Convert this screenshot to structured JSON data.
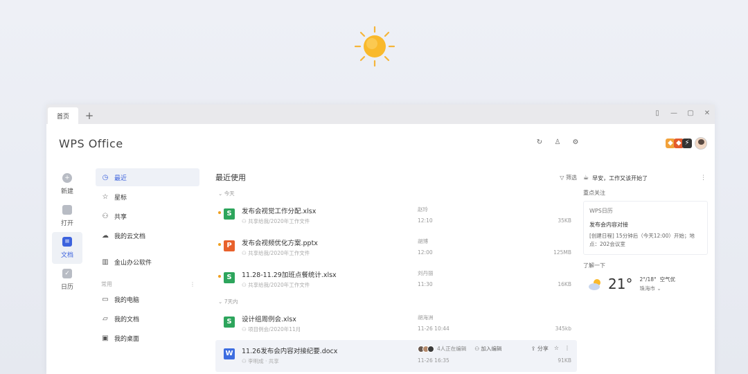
{
  "window": {
    "tab_label": "首页",
    "add_tab": "+"
  },
  "header": {
    "logo": "WPS Office"
  },
  "left_nav": [
    {
      "label": "新建",
      "icon": "plus-circle-icon"
    },
    {
      "label": "打开",
      "icon": "folder-icon"
    },
    {
      "label": "文档",
      "icon": "document-icon",
      "active": true
    },
    {
      "label": "日历",
      "icon": "calendar-icon"
    }
  ],
  "sub_nav": {
    "items": [
      {
        "label": "最近",
        "icon": "clock-icon",
        "active": true
      },
      {
        "label": "星标",
        "icon": "star-icon"
      },
      {
        "label": "共享",
        "icon": "share-icon"
      },
      {
        "label": "我的云文档",
        "icon": "cloud-icon"
      },
      {
        "label": "金山办公软件",
        "icon": "building-icon"
      }
    ],
    "section_label": "常用",
    "common_items": [
      {
        "label": "我的电脑",
        "icon": "monitor-icon"
      },
      {
        "label": "我的文档",
        "icon": "folder-icon"
      },
      {
        "label": "我的桌面",
        "icon": "desktop-icon"
      }
    ]
  },
  "main": {
    "title": "最近使用",
    "filter_label": "筛选",
    "groups": [
      {
        "label": "今天",
        "files": [
          {
            "name": "发布会视觉工作分配.xlsx",
            "type": "S",
            "color": "#2da55c",
            "path": "共享给我/2020年工作文件",
            "who": "赵玲",
            "time": "12:10",
            "size": "35KB",
            "dot": true
          },
          {
            "name": "发布会视频优化方案.pptx",
            "type": "P",
            "color": "#e8612c",
            "path": "共享给我/2020年工作文件",
            "who": "胡博",
            "time": "12:00",
            "size": "125MB",
            "dot": true
          },
          {
            "name": "11.28-11.29加班点餐统计.xlsx",
            "type": "S",
            "color": "#2da55c",
            "path": "共享给我/2020年工作文件",
            "who": "刘丹丽",
            "time": "11:30",
            "size": "16KB",
            "dot": true
          }
        ]
      },
      {
        "label": "7天内",
        "files": [
          {
            "name": "设计组周例会.xlsx",
            "type": "S",
            "color": "#2da55c",
            "path": "项目例会/2020年11月",
            "who": "胡海洲",
            "time": "11-26 10:44",
            "size": "345kb",
            "dot": false
          },
          {
            "name": "11.26发布会内容对接纪要.docx",
            "type": "W",
            "color": "#3d6de0",
            "path": "李明成 · 共享",
            "who": "",
            "time": "11-26 16:35",
            "size": "91KB",
            "dot": false,
            "hover": true
          }
        ]
      }
    ],
    "collab": {
      "editing": "4人正在编辑",
      "join": "加入编辑",
      "share": "分享"
    }
  },
  "right_panel": {
    "greeting": "早安，工作又该开始了",
    "focus_title": "重点关注",
    "calendar_card": {
      "source": "WPS日历",
      "title": "发布会内容对接",
      "detail": "[创建日程] 15分钟后（今天12:00）开始；地点：202会议室"
    },
    "learn_title": "了解一下",
    "weather": {
      "temp": "21°",
      "range": "2°/18°",
      "quality": "空气优",
      "city": "珠海市"
    }
  },
  "colors": {
    "accent": "#3d63dd",
    "xlsx": "#2da55c",
    "pptx": "#e8612c",
    "docx": "#3d6de0"
  }
}
